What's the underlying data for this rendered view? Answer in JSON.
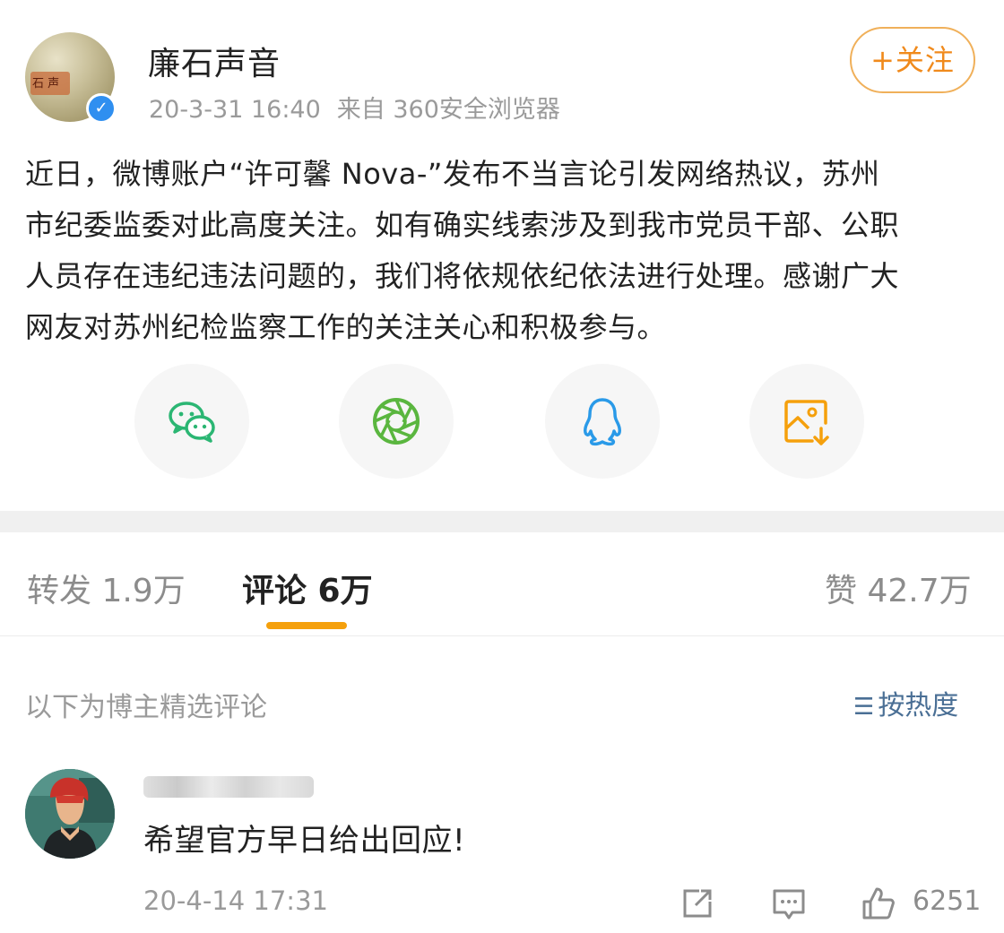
{
  "post": {
    "author": "廉石声音",
    "timestamp": "20-3-31 16:40",
    "source": "来自 360安全浏览器",
    "follow_label": "+关注",
    "body": "近日，微博账户“许可馨 Nova-”发布不当言论引发网络热议，苏州\n市纪委监委对此高度关注。如有确实线索涉及到我市党员干部、公职\n人员存在违纪违法问题的，我们将依规依纪依法进行处理。感谢广大\n网友对苏州纪检监察工作的关注关心和积极参与。",
    "avatar_seal": "石 声"
  },
  "share": {
    "icons": [
      "wechat-icon",
      "moments-icon",
      "qq-icon",
      "save-image-icon"
    ],
    "colors": {
      "wechat": "#2bb673",
      "moments": "#5ab63f",
      "qq": "#2a9ae8",
      "save": "#f5a00c"
    }
  },
  "tabs": {
    "repost": "转发 1.9万",
    "comment": "评论 6万",
    "like": "赞 42.7万",
    "active_color": "#f5a00c"
  },
  "comments_header": {
    "label": "以下为博主精选评论",
    "sort": "按热度"
  },
  "comment": {
    "text": "希望官方早日给出回应!",
    "time": "20-4-14 17:31",
    "likes": "6251"
  }
}
